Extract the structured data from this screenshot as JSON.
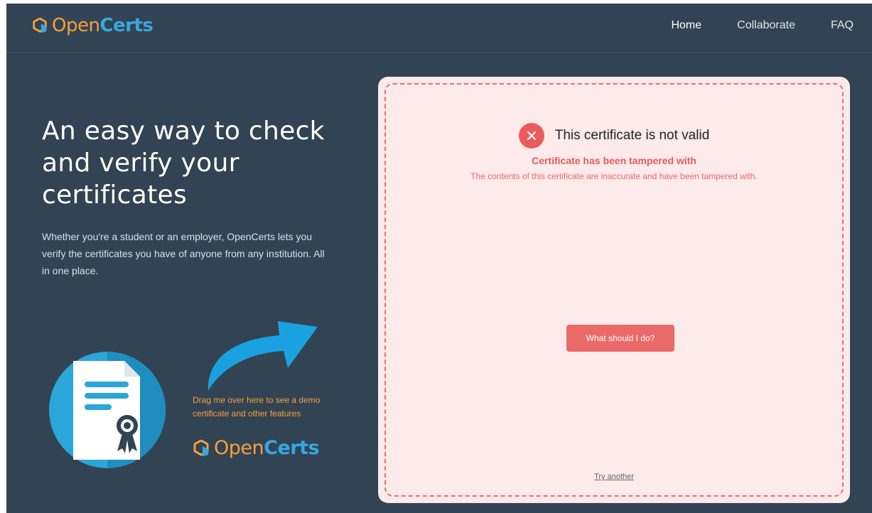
{
  "brand": {
    "part1": "Open",
    "part2": "Certs"
  },
  "nav": {
    "links": [
      "Home",
      "Collaborate",
      "FAQ"
    ]
  },
  "hero": {
    "title": "An easy way to check and verify your certificates",
    "description": "Whether you're a student or an employer, OpenCerts lets you verify the certificates you have of anyone from any institution. All in one place."
  },
  "demo": {
    "drag_text": "Drag me over here to see a demo certificate and other features",
    "icons": [
      "certificate-document-icon",
      "award-ribbon-icon",
      "curved-arrow-icon",
      "opencerts-logo-icon"
    ]
  },
  "verification": {
    "status_title": "This certificate is not valid",
    "error_title": "Certificate has been tampered with",
    "error_description": "The contents of this certificate are inaccurate and have been tampered with.",
    "action_button": "What should I do?",
    "try_another": "Try another",
    "status_icon": "close-icon"
  },
  "colors": {
    "background": "#324353",
    "brand_orange": "#f7a040",
    "brand_blue": "#36a8e0",
    "error_red": "#ec5b5b",
    "panel_bg": "#fdeaea"
  }
}
